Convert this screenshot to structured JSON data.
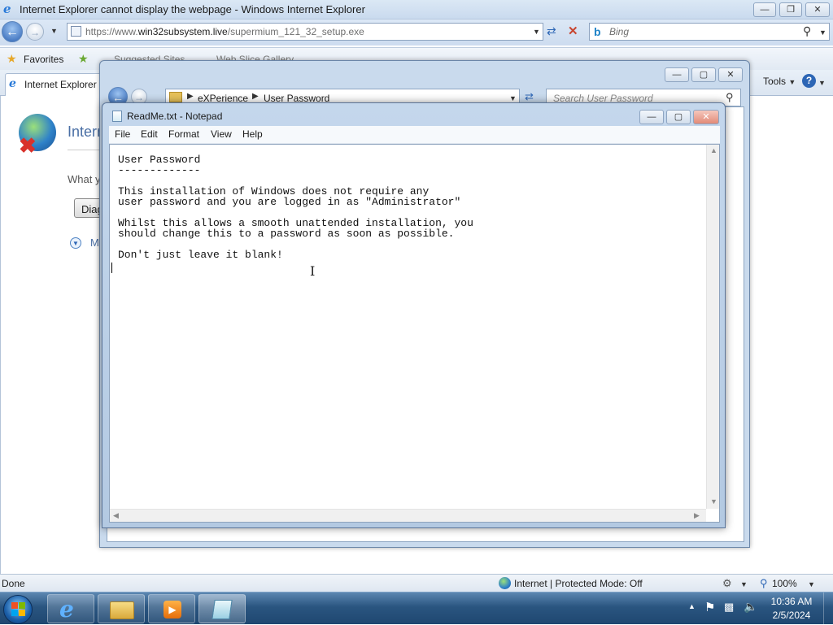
{
  "ie": {
    "window_title": "Internet Explorer cannot display the webpage - Windows Internet Explorer",
    "address": {
      "prefix": "https://www.",
      "host": "win32subsystem.live",
      "path": "/supermium_121_32_setup.exe"
    },
    "search_placeholder": "Bing",
    "favorites_label": "Favorites",
    "suggested_sites": "Suggested Sites",
    "web_slice_gallery": "Web Slice Gallery",
    "tab_label": "Internet Explorer c",
    "tools_label": "Tools",
    "content": {
      "heading_partial": "Interr",
      "question_partial": "What y",
      "diagnose_partial": "Diag",
      "more_partial": "M"
    },
    "status": {
      "left": "Done",
      "zone": "Internet | Protected Mode: Off",
      "zoom": "100%"
    }
  },
  "explorer": {
    "breadcrumb": [
      "eXPerience",
      "User Password"
    ],
    "search_placeholder": "Search User Password"
  },
  "notepad": {
    "title": "ReadMe.txt - Notepad",
    "menu": [
      "File",
      "Edit",
      "Format",
      "View",
      "Help"
    ],
    "text": "User Password\n-------------\n\nThis installation of Windows does not require any\nuser password and you are logged in as \"Administrator\"\n\nWhilst this allows a smooth unattended installation, you\nshould change this to a password as soon as possible.\n\nDon't just leave it blank!\n"
  },
  "taskbar": {
    "clock_time": "10:36 AM",
    "clock_date": "2/5/2024",
    "items": [
      "internet-explorer",
      "windows-explorer",
      "media-player",
      "notepad"
    ]
  },
  "colors": {
    "accent": "#2c62b4",
    "taskbar": "#2a5580",
    "close_red": "#c8452f"
  }
}
